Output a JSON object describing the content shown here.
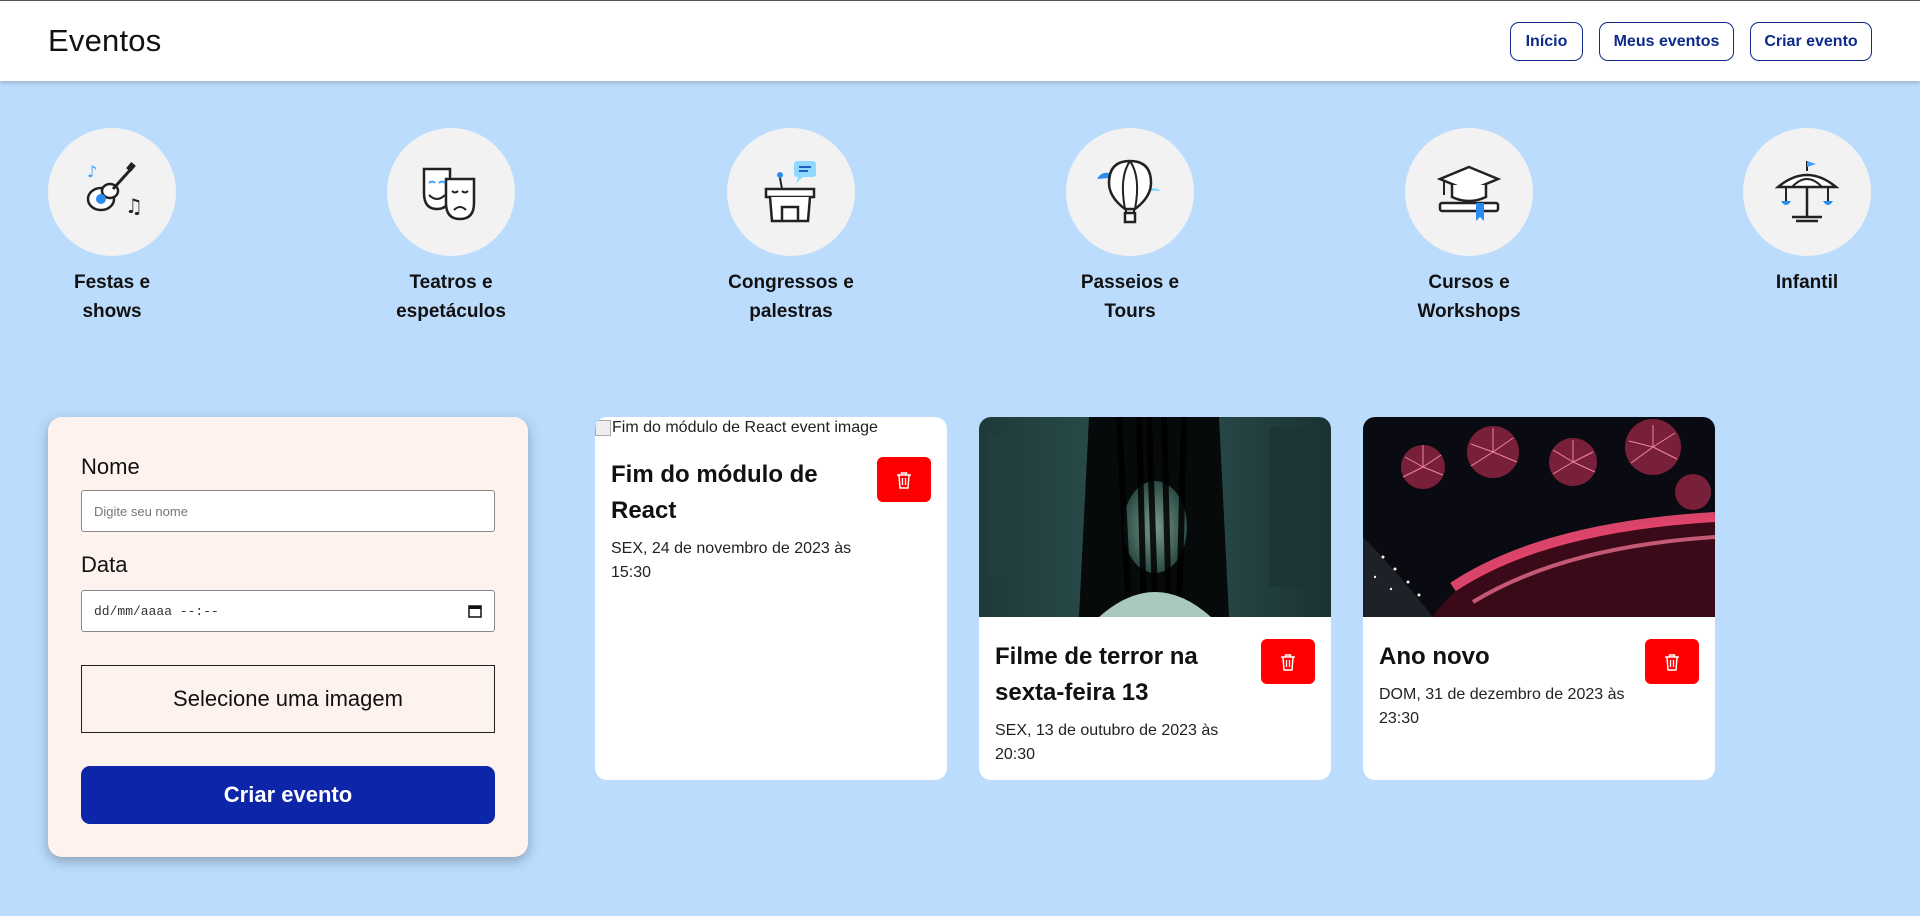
{
  "header": {
    "brand": "Eventos",
    "nav": [
      {
        "label": "Início"
      },
      {
        "label": "Meus eventos"
      },
      {
        "label": "Criar evento"
      }
    ]
  },
  "categories": [
    {
      "label": "Festas e shows",
      "icon": "guitar-icon"
    },
    {
      "label": "Teatros e espetáculos",
      "icon": "theater-masks-icon"
    },
    {
      "label": "Congressos e palestras",
      "icon": "podium-icon"
    },
    {
      "label": "Passeios e Tours",
      "icon": "hot-air-balloon-icon"
    },
    {
      "label": "Cursos e Workshops",
      "icon": "graduation-cap-icon"
    },
    {
      "label": "Infantil",
      "icon": "carousel-icon"
    }
  ],
  "form": {
    "name_label": "Nome",
    "name_placeholder": "Digite seu nome",
    "date_label": "Data",
    "date_placeholder": "dd/mm/aaaa --:--",
    "image_button": "Selecione uma imagem",
    "submit_label": "Criar evento"
  },
  "events": [
    {
      "image_alt": "Fim do módulo de React event image",
      "title": "Fim do módulo de React",
      "date": "SEX, 24 de novembro de 2023 às 15:30"
    },
    {
      "image_alt": "Filme de terror na sexta-feira 13 event image",
      "title": "Filme de terror na sexta-feira 13",
      "date": "SEX, 13 de outubro de 2023 às 20:30"
    },
    {
      "image_alt": "Ano novo event image",
      "title": "Ano novo",
      "date": "DOM, 31 de dezembro de 2023 às 23:30"
    }
  ],
  "colors": {
    "page_bg": "#bbdcfc",
    "brand_blue": "#0d25a8",
    "delete_red": "#ff0000",
    "form_bg": "#fdf2ee"
  }
}
